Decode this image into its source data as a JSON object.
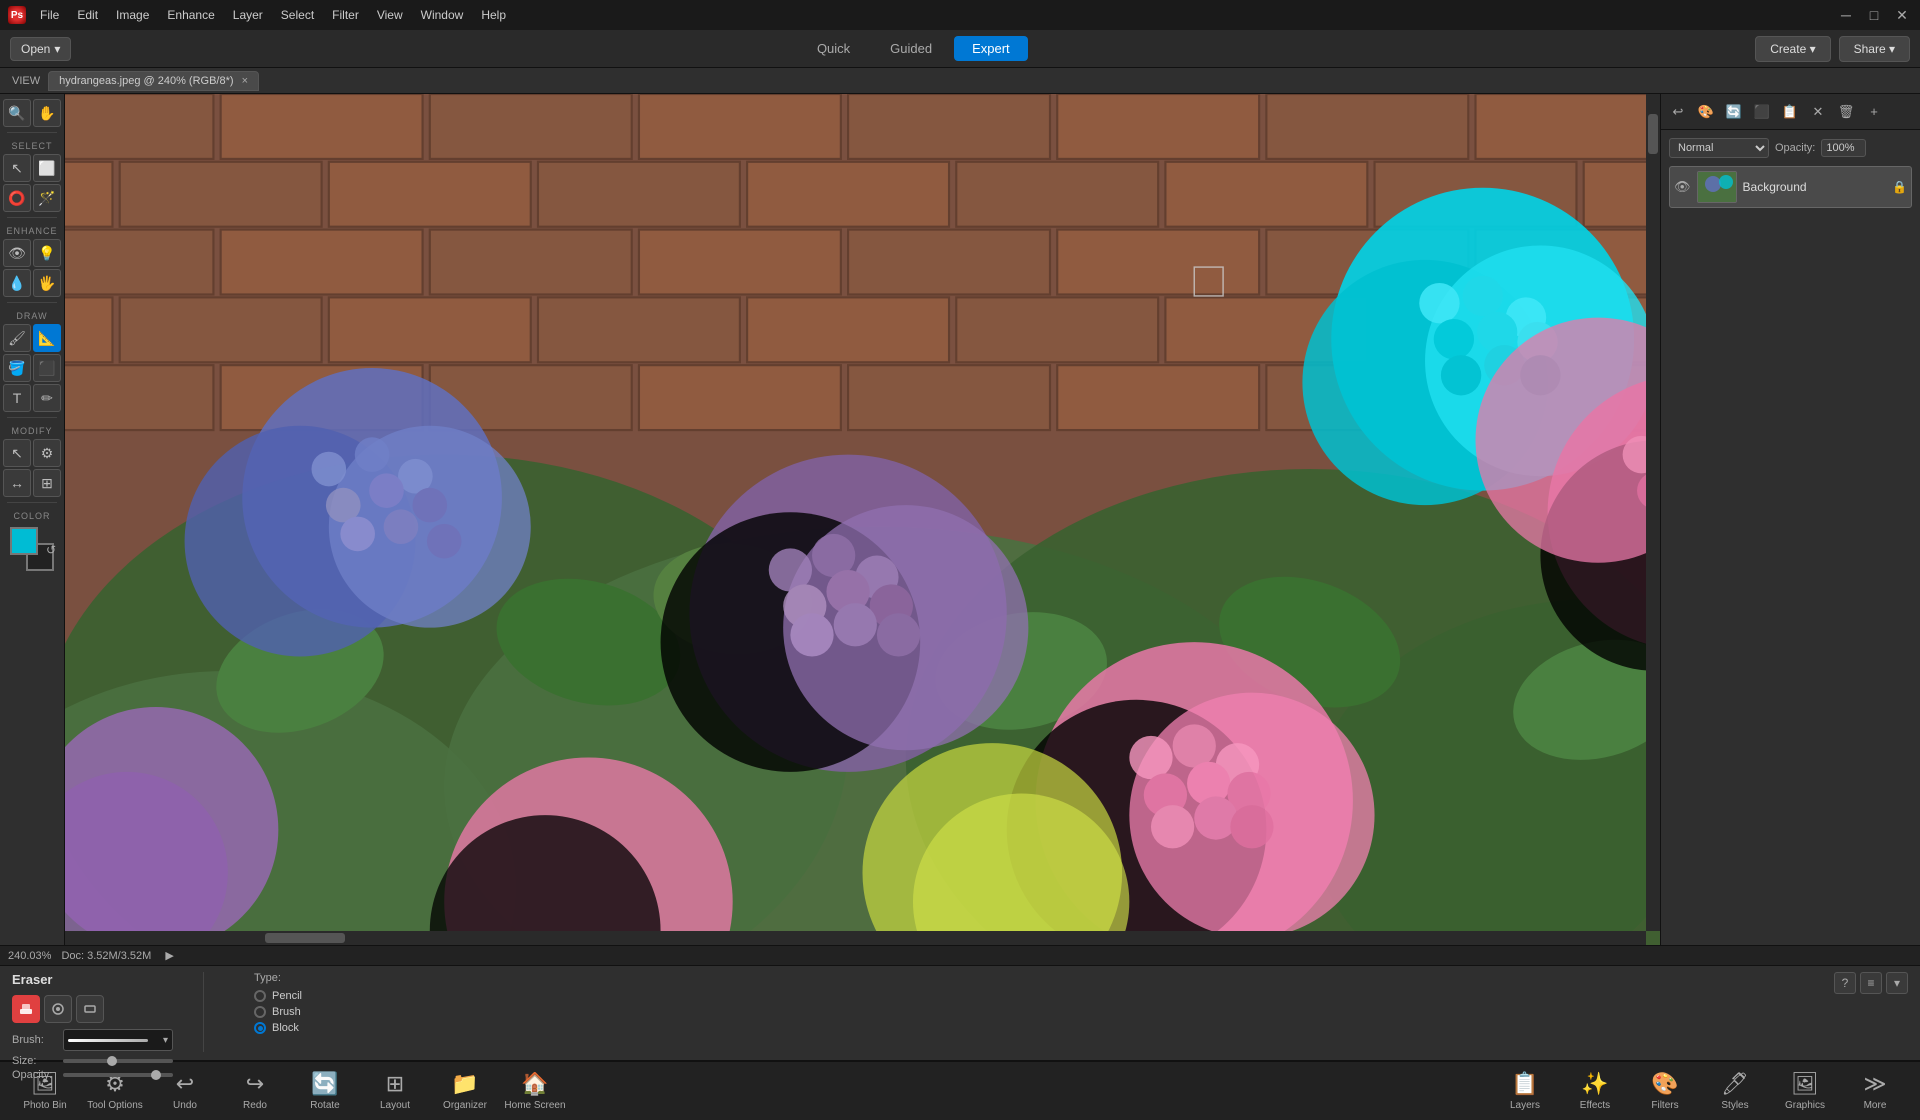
{
  "app": {
    "title": "Adobe Photoshop Elements",
    "icon": "Ps"
  },
  "titlebar": {
    "menus": [
      "File",
      "Edit",
      "Image",
      "Enhance",
      "Layer",
      "Select",
      "Filter",
      "View",
      "Window",
      "Help"
    ],
    "win_btns": [
      "─",
      "□",
      "✕"
    ]
  },
  "modebar": {
    "open_label": "Open",
    "open_arrow": "▾",
    "mode_tabs": [
      "Quick",
      "Guided",
      "Expert"
    ],
    "active_tab": "Expert",
    "create_label": "Create",
    "share_label": "Share"
  },
  "tabbar": {
    "view_label": "VIEW",
    "doc_tab": "hydrangeas.jpeg @ 240% (RGB/8*)",
    "close_x": "×"
  },
  "toolbar": {
    "select_label": "SELECT",
    "enhance_label": "ENHANCE",
    "draw_label": "DRAW",
    "modify_label": "MODIFY",
    "color_label": "COLOR",
    "tools": {
      "view": [
        "🔍",
        "✋"
      ],
      "select": [
        "↖",
        "⬜",
        "⭕",
        "🪄"
      ],
      "enhance": [
        "👁",
        "✏",
        "💧",
        "✋"
      ],
      "draw": [
        "✏",
        "📐",
        "🖌",
        "⬛",
        "T",
        "〜"
      ],
      "modify": [
        "↖",
        "⚙",
        "↔",
        "⊞"
      ]
    },
    "fg_color": "#00bcd4",
    "bg_color": "#222222"
  },
  "canvas": {
    "zoom_pct": "240.03%",
    "doc_size": "Doc: 3.52M/3.52M"
  },
  "rightpanel": {
    "blend_mode": "Normal",
    "opacity_label": "Opacity:",
    "opacity_value": "100%",
    "layer_name": "Background",
    "eye_icon": "👁"
  },
  "tooloptions": {
    "tool_name": "Eraser",
    "brush_label": "Brush:",
    "size_label": "Size:",
    "opacity_label": "Opacity:",
    "type_label": "Type:",
    "type_options": [
      "Pencil",
      "Brush",
      "Block"
    ],
    "selected_type": "Block"
  },
  "statusbar": {
    "zoom": "240.03%",
    "doc": "Doc: 3.52M/3.52M"
  },
  "bottomdock": {
    "items": [
      {
        "id": "photo-bin",
        "icon": "🖼",
        "label": "Photo Bin"
      },
      {
        "id": "tool-options",
        "icon": "⚙",
        "label": "Tool Options"
      },
      {
        "id": "undo",
        "icon": "↩",
        "label": "Undo"
      },
      {
        "id": "redo",
        "icon": "↪",
        "label": "Redo"
      },
      {
        "id": "rotate",
        "icon": "🔄",
        "label": "Rotate"
      },
      {
        "id": "layout",
        "icon": "⬛",
        "label": "Layout"
      },
      {
        "id": "organizer",
        "icon": "📁",
        "label": "Organizer"
      },
      {
        "id": "home-screen",
        "icon": "🏠",
        "label": "Home Screen"
      }
    ],
    "right_items": [
      {
        "id": "layers",
        "icon": "📋",
        "label": "Layers"
      },
      {
        "id": "effects",
        "icon": "✨",
        "label": "Effects"
      },
      {
        "id": "filters",
        "icon": "🎨",
        "label": "Filters"
      },
      {
        "id": "styles",
        "icon": "🖊",
        "label": "Styles"
      },
      {
        "id": "graphics",
        "icon": "🖼",
        "label": "Graphics"
      },
      {
        "id": "more",
        "icon": "≫",
        "label": "More"
      }
    ]
  }
}
